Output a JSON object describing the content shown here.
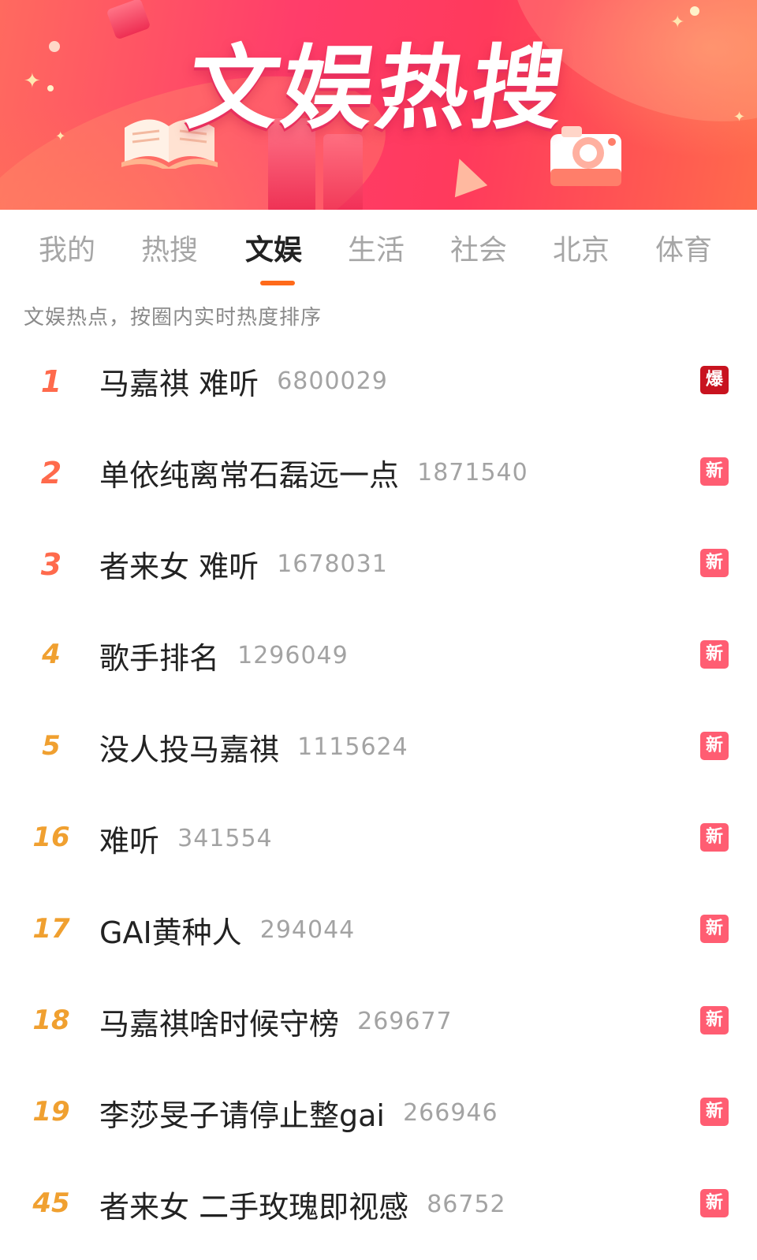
{
  "banner": {
    "title": "文娱热搜"
  },
  "tabs": [
    {
      "label": "我的"
    },
    {
      "label": "热搜"
    },
    {
      "label": "文娱"
    },
    {
      "label": "生活"
    },
    {
      "label": "社会"
    },
    {
      "label": "北京"
    },
    {
      "label": "体育"
    }
  ],
  "active_tab": "文娱",
  "subtitle": "文娱热点，按圈内实时热度排序",
  "colors": {
    "accent_underline": "#ff6a1a",
    "rank_top": "#ff6a4c",
    "rank_other": "#f0a030",
    "badge_new": "#ff5d72",
    "badge_hot": "#c8131f"
  },
  "items": [
    {
      "rank": "1",
      "title": "马嘉祺 难听",
      "heat": "6800029",
      "badge": "爆"
    },
    {
      "rank": "2",
      "title": "单依纯离常石磊远一点",
      "heat": "1871540",
      "badge": "新"
    },
    {
      "rank": "3",
      "title": "者来女 难听",
      "heat": "1678031",
      "badge": "新"
    },
    {
      "rank": "4",
      "title": "歌手排名",
      "heat": "1296049",
      "badge": "新"
    },
    {
      "rank": "5",
      "title": "没人投马嘉祺",
      "heat": "1115624",
      "badge": "新"
    },
    {
      "rank": "16",
      "title": "难听",
      "heat": "341554",
      "badge": "新"
    },
    {
      "rank": "17",
      "title": "GAI黄种人",
      "heat": "294044",
      "badge": "新"
    },
    {
      "rank": "18",
      "title": "马嘉祺啥时候守榜",
      "heat": "269677",
      "badge": "新"
    },
    {
      "rank": "19",
      "title": "李莎旻子请停止整gai",
      "heat": "266946",
      "badge": "新"
    },
    {
      "rank": "45",
      "title": "者来女 二手玫瑰即视感",
      "heat": "86752",
      "badge": "新"
    }
  ]
}
